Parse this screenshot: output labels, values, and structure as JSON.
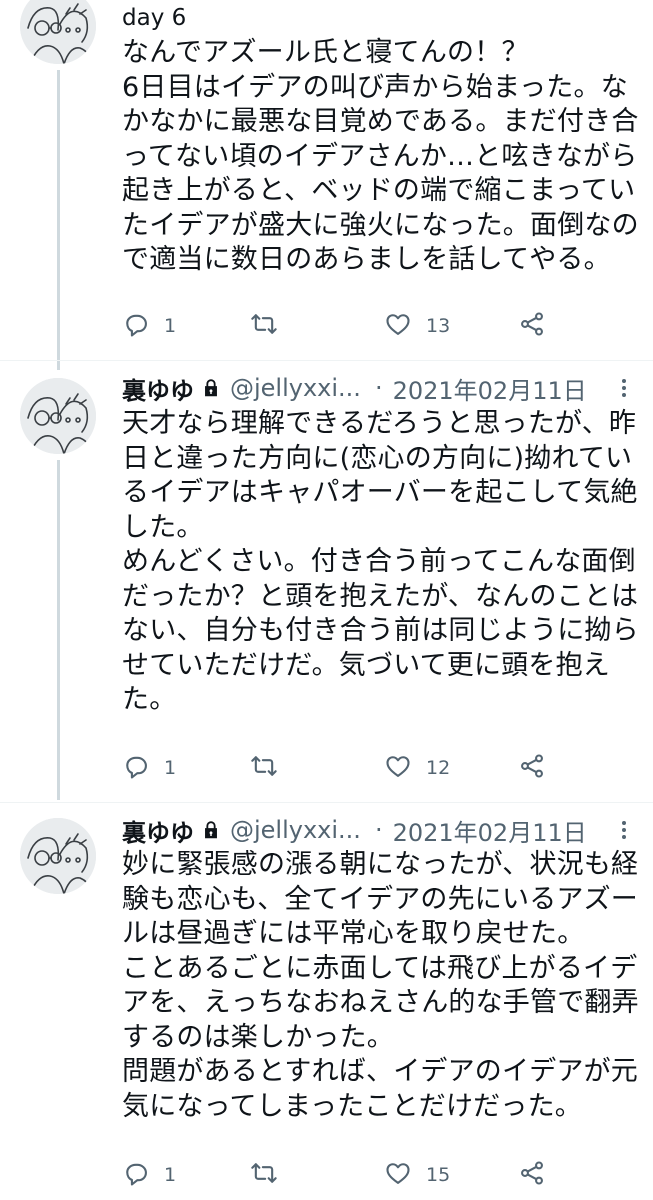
{
  "tweets": [
    {
      "header_text": "day 6",
      "body": "なんでアズール氏と寝てんの！？\n6日目はイデアの叫び声から始まった。なかなかに最悪な目覚めである。まだ付き合ってない頃のイデアさんか…と呟きながら起き上がると、ベッドの端で縮こまっていたイデアが盛大に強火になった。面倒なので適当に数日のあらましを話してやる。",
      "replies": "1",
      "retweets": "",
      "likes": "13"
    },
    {
      "name": "裏ゆゆ",
      "handle": "@jellyxxi...",
      "dot": "·",
      "date": "2021年02月11日",
      "body": "天才なら理解できるだろうと思ったが、昨日と違った方向に(恋心の方向に)拗れているイデアはキャパオーバーを起こして気絶した。\nめんどくさい。付き合う前ってこんな面倒だったか？と頭を抱えたが、なんのことはない、自分も付き合う前は同じように拗らせていただけだ。気づいて更に頭を抱えた。",
      "replies": "1",
      "retweets": "",
      "likes": "12"
    },
    {
      "name": "裏ゆゆ",
      "handle": "@jellyxxi...",
      "dot": "·",
      "date": "2021年02月11日",
      "body": "妙に緊張感の漲る朝になったが、状況も経験も恋心も、全てイデアの先にいるアズールは昼過ぎには平常心を取り戻せた。\nことあるごとに赤面しては飛び上がるイデアを、えっちなおねえさん的な手管で翻弄するのは楽しかった。\n問題があるとすれば、イデアのイデアが元気になってしまったことだけだった。",
      "replies": "1",
      "retweets": "",
      "likes": "15"
    }
  ],
  "icons": {
    "reply": "reply-icon",
    "retweet": "retweet-icon",
    "like": "heart-icon",
    "share": "share-icon",
    "lock": "lock-icon",
    "more": "more-icon"
  },
  "colors": {
    "text": "#0f1419",
    "secondary": "#536471",
    "thread_line": "#cfd9de",
    "avatar_bg": "#e9ecee"
  }
}
